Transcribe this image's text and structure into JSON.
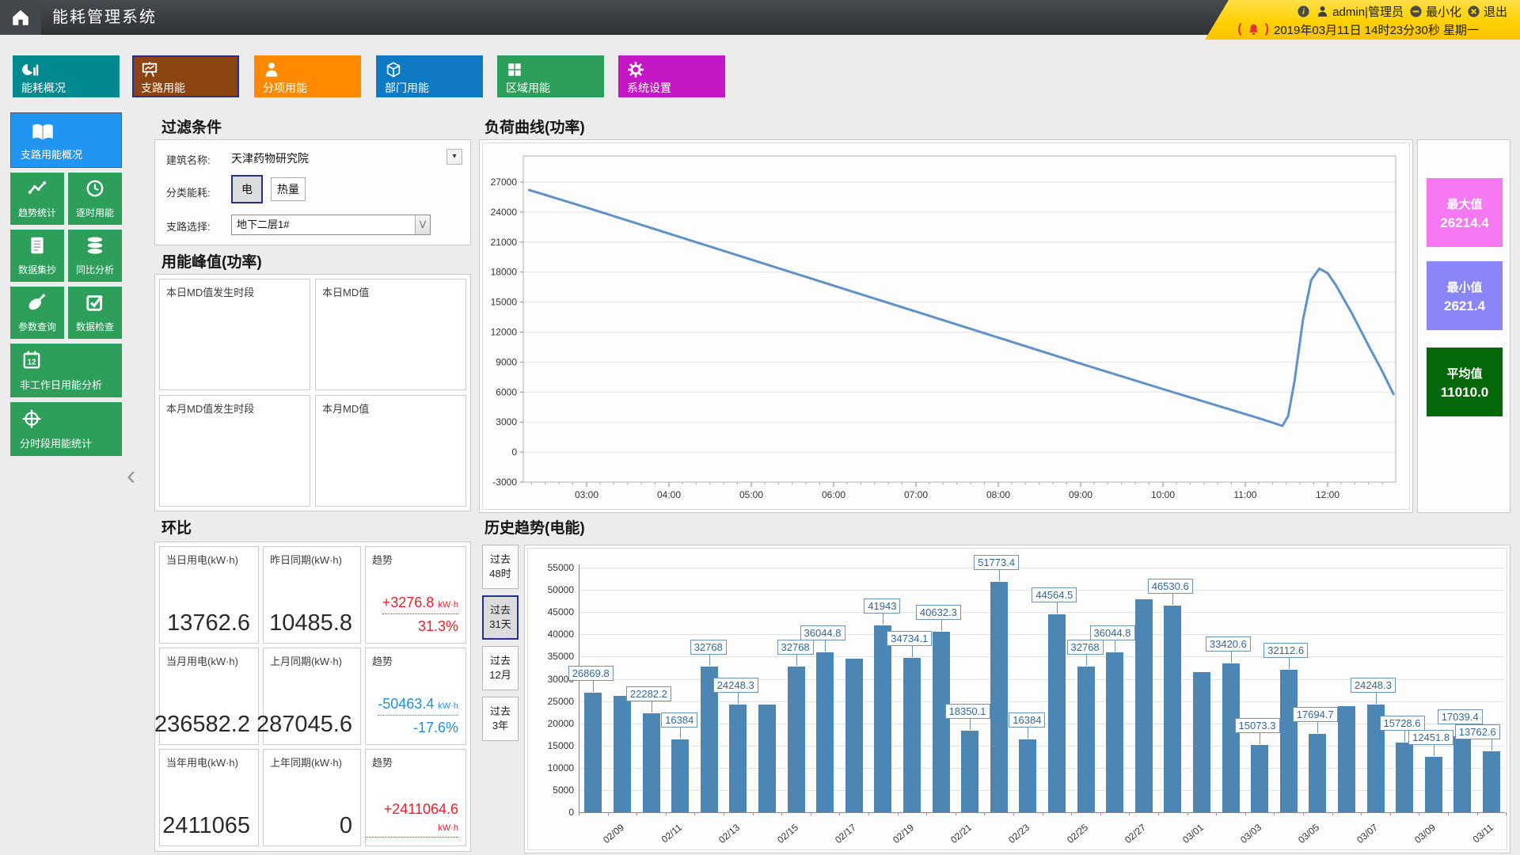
{
  "app": {
    "title": "能耗管理系统"
  },
  "topbar": {
    "user": "admin|管理员",
    "minimize": "最小化",
    "logout": "退出",
    "datetime": "2019年03月11日 14时23分30秒 星期一"
  },
  "nav": {
    "tabs": [
      {
        "label": "能耗概况",
        "color": "#00898e",
        "icon": "donut-chart",
        "selected": false
      },
      {
        "label": "支路用能",
        "color": "#8c4510",
        "icon": "presentation-chart",
        "selected": true
      },
      {
        "label": "分项用能",
        "color": "#ff8a00",
        "icon": "person",
        "selected": false
      },
      {
        "label": "部门用能",
        "color": "#0e7ac4",
        "icon": "cube",
        "selected": false
      },
      {
        "label": "区域用能",
        "color": "#2e9e5b",
        "icon": "grid",
        "selected": false
      },
      {
        "label": "系统设置",
        "color": "#c617c6",
        "icon": "gear",
        "selected": false
      }
    ]
  },
  "sidebar": {
    "items": [
      {
        "label": "支路用能概况",
        "icon": "book",
        "wide": true,
        "selected": true
      },
      {
        "label": "趋势统计",
        "icon": "line-chart",
        "wide": false,
        "selected": false
      },
      {
        "label": "逐时用能",
        "icon": "clock",
        "wide": false,
        "selected": false
      },
      {
        "label": "数据集抄",
        "icon": "document",
        "wide": false,
        "selected": false
      },
      {
        "label": "同比分析",
        "icon": "database",
        "wide": false,
        "selected": false
      },
      {
        "label": "参数查询",
        "icon": "satellite-dish",
        "wide": false,
        "selected": false
      },
      {
        "label": "数据检查",
        "icon": "check-square",
        "wide": false,
        "selected": false
      },
      {
        "label": "非工作日用能分析",
        "icon": "calendar-12",
        "wide": true,
        "selected": false
      },
      {
        "label": "分时段用能统计",
        "icon": "crosshair",
        "wide": true,
        "selected": false
      }
    ]
  },
  "filter": {
    "title": "过滤条件",
    "building_label": "建筑名称:",
    "building_value": "天津药物研究院",
    "energy_label": "分类能耗:",
    "energy_options": [
      "电",
      "热量"
    ],
    "energy_selected": "电",
    "branch_label": "支路选择:",
    "branch_value": "地下二层1#"
  },
  "peak": {
    "title": "用能峰值(功率)",
    "boxes": [
      "本日MD值发生时段",
      "本日MD值",
      "本月MD值发生时段",
      "本月MD值"
    ]
  },
  "huanbi": {
    "title": "环比",
    "up_color": "#e8212b",
    "down_color": "#1e8fe8",
    "rows": [
      {
        "cells": [
          {
            "type": "value",
            "label": "当日用电(kW·h)",
            "value": "13762.6"
          },
          {
            "type": "value",
            "label": "昨日同期(kW·h)",
            "value": "10485.8"
          },
          {
            "type": "trend",
            "label": "趋势",
            "delta": "+3276.8",
            "unit": "kW·h",
            "percent": "31.3%",
            "direction": "up"
          }
        ]
      },
      {
        "cells": [
          {
            "type": "value",
            "label": "当月用电(kW·h)",
            "value": "236582.2"
          },
          {
            "type": "value",
            "label": "上月同期(kW·h)",
            "value": "287045.6"
          },
          {
            "type": "trend",
            "label": "趋势",
            "delta": "-50463.4",
            "unit": "kW·h",
            "percent": "-17.6%",
            "direction": "down"
          }
        ]
      },
      {
        "cells": [
          {
            "type": "value",
            "label": "当年用电(kW·h)",
            "value": "2411065"
          },
          {
            "type": "value",
            "label": "上年同期(kW·h)",
            "value": "0"
          },
          {
            "type": "trend",
            "label": "趋势",
            "delta": "+2411064.6",
            "unit": "kW·h",
            "percent": "",
            "direction": "up"
          }
        ]
      }
    ]
  },
  "history": {
    "buttons": [
      "过去48时",
      "过去31天",
      "过去12月",
      "过去3年"
    ],
    "selected": "过去31天"
  },
  "chart_data": [
    {
      "type": "line",
      "title": "负荷曲线(功率)",
      "xlabel": "",
      "ylabel": "",
      "ylim": [
        -3000,
        27000
      ],
      "ytick_step": 3000,
      "grid": true,
      "xticks": [
        "03:00",
        "04:00",
        "05:00",
        "06:00",
        "07:00",
        "08:00",
        "09:00",
        "10:00",
        "11:00",
        "12:00"
      ],
      "line_color": "#5e92c8",
      "points": [
        [
          2.3,
          26214.4
        ],
        [
          3,
          24450
        ],
        [
          4,
          21850
        ],
        [
          5,
          19250
        ],
        [
          6,
          16650
        ],
        [
          7,
          14050
        ],
        [
          8,
          11450
        ],
        [
          9,
          8850
        ],
        [
          10,
          6300
        ],
        [
          10.5,
          5050
        ],
        [
          11,
          3800
        ],
        [
          11.2,
          3300
        ],
        [
          11.35,
          2900
        ],
        [
          11.45,
          2621.4
        ],
        [
          11.52,
          3600
        ],
        [
          11.6,
          7200
        ],
        [
          11.7,
          13200
        ],
        [
          11.8,
          17200
        ],
        [
          11.9,
          18350
        ],
        [
          12.0,
          17900
        ],
        [
          12.1,
          16700
        ],
        [
          12.3,
          13800
        ],
        [
          12.5,
          10600
        ],
        [
          12.65,
          8300
        ],
        [
          12.8,
          5800
        ]
      ],
      "stats": [
        {
          "label": "最大值",
          "value": "26214.4",
          "color": "#f678f2"
        },
        {
          "label": "最小值",
          "value": "2621.4",
          "color": "#8a85f8"
        },
        {
          "label": "平均值",
          "value": "11010.0",
          "color": "#05690b"
        }
      ]
    },
    {
      "type": "bar",
      "title": "历史趋势(电能)",
      "xlabel": "",
      "ylabel": "",
      "ylim": [
        0,
        55000
      ],
      "ytick_step": 5000,
      "grid": true,
      "bar_color": "#4b86b4",
      "xtick_dates": [
        "02/09",
        "02/11",
        "02/13",
        "02/15",
        "02/17",
        "02/19",
        "02/21",
        "02/23",
        "02/25",
        "02/27",
        "03/01",
        "03/03",
        "03/05",
        "03/07",
        "03/09",
        "03/11"
      ],
      "bars": [
        {
          "value": 26869.8,
          "label": "26869.8"
        },
        {
          "value": 26200,
          "label": null
        },
        {
          "value": 22282.2,
          "label": "22282.2"
        },
        {
          "value": 16384,
          "label": "16384"
        },
        {
          "value": 32768,
          "label": "32768"
        },
        {
          "value": 24248.3,
          "label": "24248.3"
        },
        {
          "value": 24200,
          "label": null
        },
        {
          "value": 32768,
          "label": "32768"
        },
        {
          "value": 36044.8,
          "label": "36044.8"
        },
        {
          "value": 34600,
          "label": null
        },
        {
          "value": 41943,
          "label": "41943"
        },
        {
          "value": 34734.1,
          "label": "34734.1"
        },
        {
          "value": 40632.3,
          "label": "40632.3"
        },
        {
          "value": 18350.1,
          "label": "18350.1"
        },
        {
          "value": 51773.4,
          "label": "51773.4"
        },
        {
          "value": 16384,
          "label": "16384"
        },
        {
          "value": 44564.5,
          "label": "44564.5"
        },
        {
          "value": 32768,
          "label": "32768"
        },
        {
          "value": 36044.8,
          "label": "36044.8"
        },
        {
          "value": 47900,
          "label": null
        },
        {
          "value": 46530.6,
          "label": "46530.6"
        },
        {
          "value": 31500,
          "label": null
        },
        {
          "value": 33420.6,
          "label": "33420.6"
        },
        {
          "value": 15073.3,
          "label": "15073.3"
        },
        {
          "value": 32112.6,
          "label": "32112.6"
        },
        {
          "value": 17694.7,
          "label": "17694.7"
        },
        {
          "value": 23800,
          "label": null
        },
        {
          "value": 24248.3,
          "label": "24248.3"
        },
        {
          "value": 15728.6,
          "label": "15728.6"
        },
        {
          "value": 12451.8,
          "label": "12451.8"
        },
        {
          "value": 17039.4,
          "label": "17039.4"
        },
        {
          "value": 13762.6,
          "label": "13762.6"
        }
      ]
    }
  ]
}
